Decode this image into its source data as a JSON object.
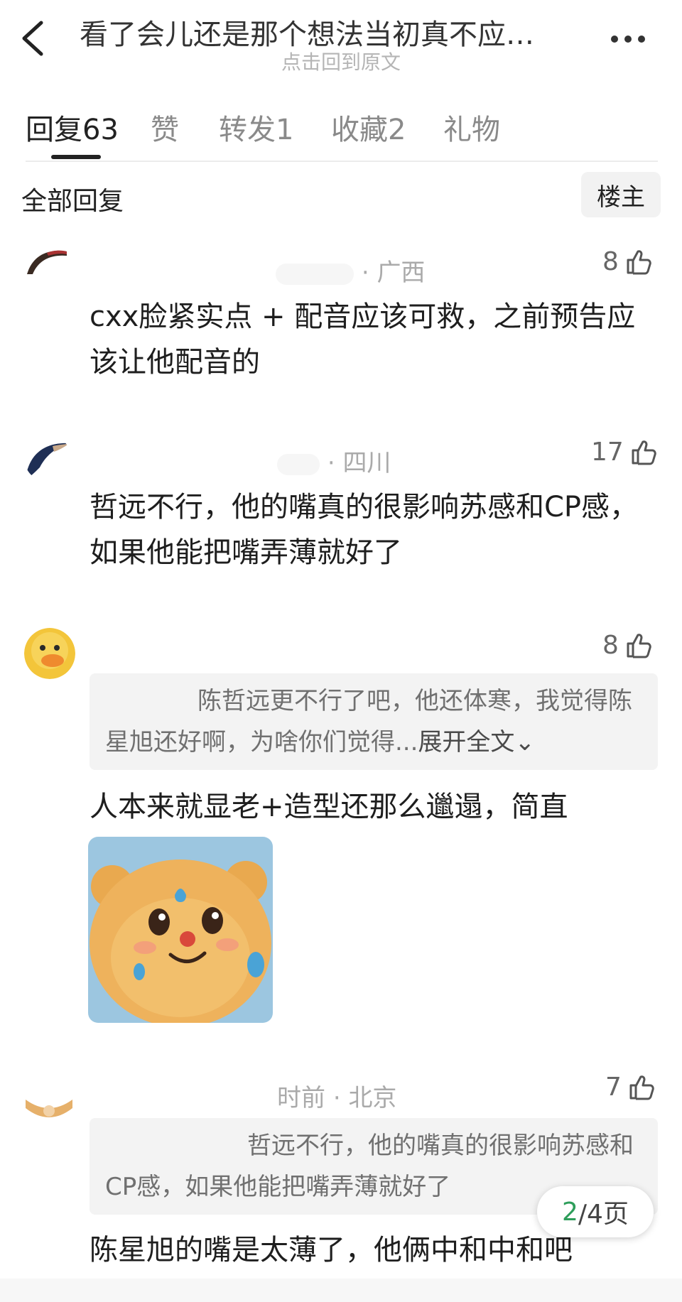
{
  "header": {
    "title": "看了会儿还是那个想法当初真不应…",
    "subtitle": "点击回到原文"
  },
  "tabs": [
    {
      "label": "回复",
      "count": "63"
    },
    {
      "label": "赞"
    },
    {
      "label": "转发",
      "count": "1"
    },
    {
      "label": "收藏",
      "count": "2"
    },
    {
      "label": "礼物"
    }
  ],
  "filter": {
    "label": "全部回复",
    "owner_button": "楼主"
  },
  "comments": [
    {
      "location": "广西",
      "likes": "8",
      "text": "cxx脸紧实点 + 配音应该可救，之前预告应该让他配音的"
    },
    {
      "location": "四川",
      "likes": "17",
      "text": "哲远不行，他的嘴真的很影响苏感和CP感，如果他能把嘴弄薄就好了"
    },
    {
      "likes": "8",
      "quote": "陈哲远更不行了吧，他还体寒，我觉得陈星旭还好啊，为啥你们觉得...",
      "quote_expand": "展开全文",
      "text": "人本来就显老+造型还那么邋遢，简直"
    },
    {
      "time": "时前",
      "location": "北京",
      "likes": "7",
      "quote": "哲远不行，他的嘴真的很影响苏感和CP感，如果他能把嘴弄薄就好了",
      "text": "陈星旭的嘴是太薄了，他俩中和中和吧"
    }
  ],
  "pager": {
    "current": "2",
    "total": "/4页"
  },
  "colors": {
    "accent_green": "#2e9e5b",
    "meta_gray": "#aaaaaa",
    "quote_bg": "#f3f3f3"
  },
  "icons": [
    "back-arrow-icon",
    "more-dots-icon",
    "thumbs-up-icon"
  ]
}
